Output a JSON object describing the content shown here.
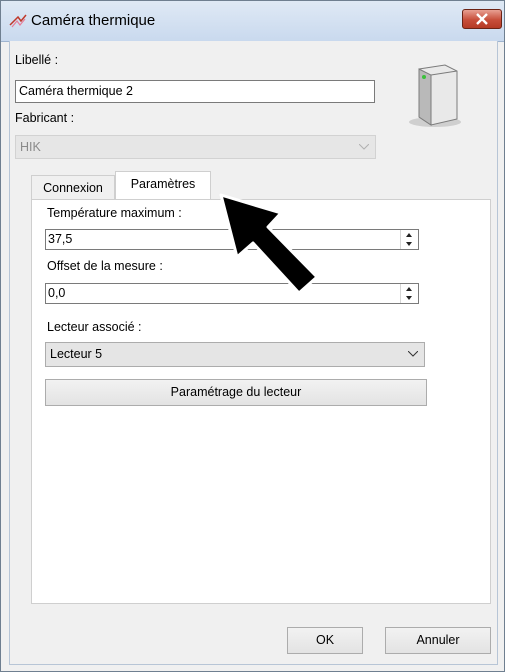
{
  "window": {
    "title": "Caméra thermique",
    "title_icon": "thermal-camera-icon",
    "close_icon": "close-icon"
  },
  "form": {
    "libelle_label": "Libellé :",
    "libelle_value": "Caméra thermique 2",
    "fabricant_label": "Fabricant :",
    "fabricant_value": "HIK",
    "device_icon": "server-icon"
  },
  "tabs": [
    {
      "label": "Connexion",
      "selected": false
    },
    {
      "label": "Paramètres",
      "selected": true
    }
  ],
  "parametres": {
    "temp_max_label": "Température maximum :",
    "temp_max_value": "37,5",
    "offset_label": "Offset de la mesure :",
    "offset_value": "0,0",
    "lecteur_label": "Lecteur associé :",
    "lecteur_value": "Lecteur 5",
    "param_button": "Paramétrage du lecteur"
  },
  "footer": {
    "ok": "OK",
    "cancel": "Annuler"
  },
  "overlay": {
    "cursor_icon": "mouse-pointer-arrow-icon"
  }
}
